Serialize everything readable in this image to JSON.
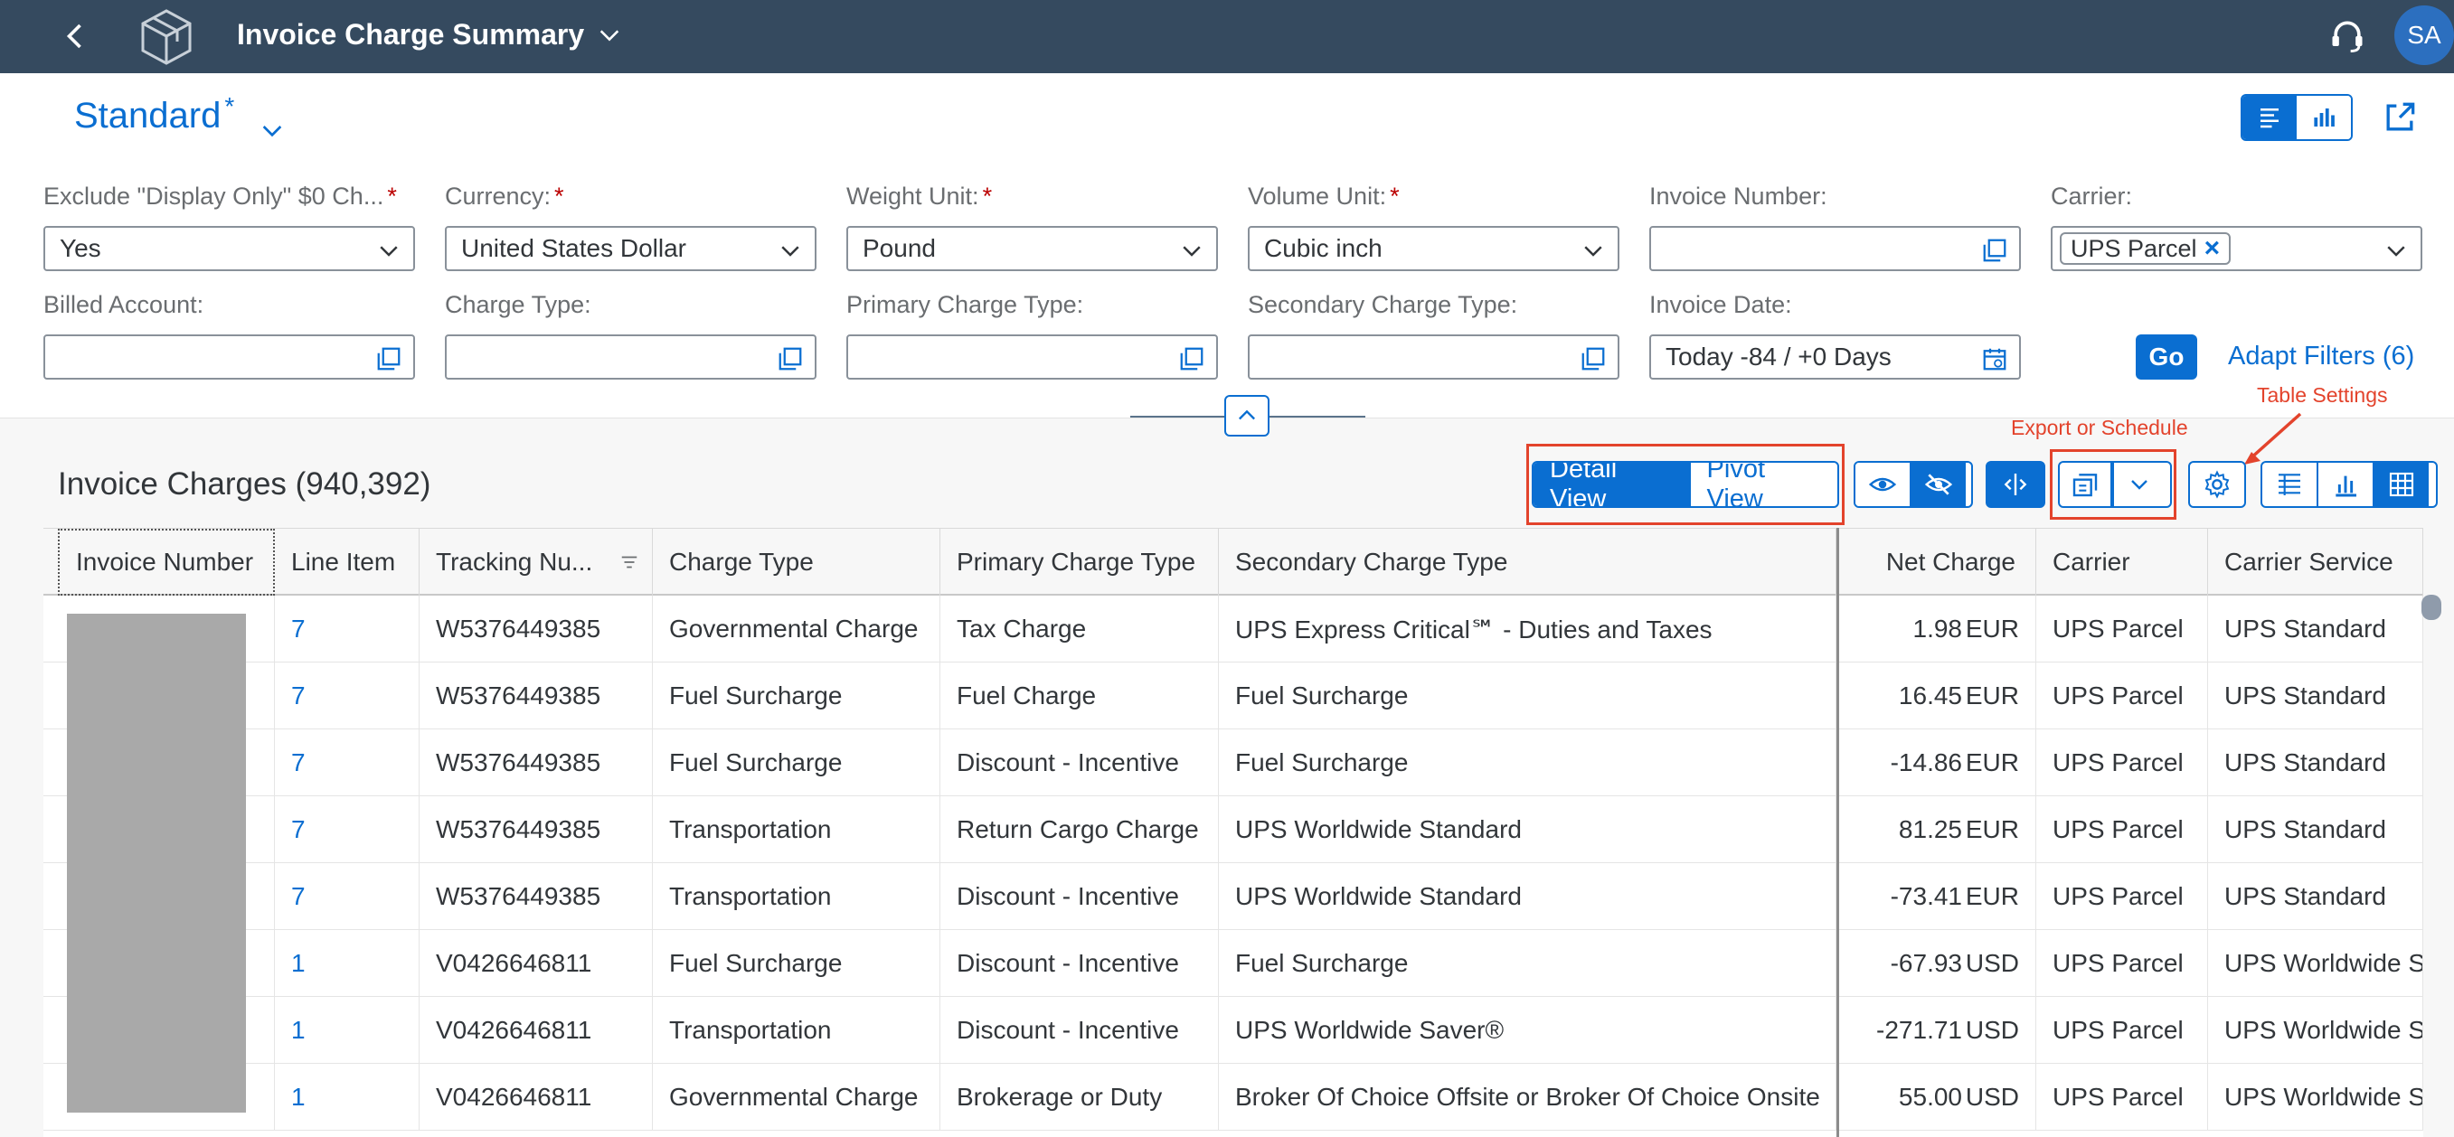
{
  "shell": {
    "title": "Invoice Charge Summary",
    "avatar": "SA"
  },
  "variant": {
    "name": "Standard",
    "modified_marker": "*"
  },
  "filters": [
    {
      "label": "Exclude \"Display Only\" $0 Ch...",
      "required": true,
      "value": "Yes",
      "icon": "chevron-down-icon"
    },
    {
      "label": "Currency:",
      "required": true,
      "value": "United States Dollar",
      "icon": "chevron-down-icon"
    },
    {
      "label": "Weight Unit:",
      "required": true,
      "value": "Pound",
      "icon": "chevron-down-icon"
    },
    {
      "label": "Volume Unit:",
      "required": true,
      "value": "Cubic inch",
      "icon": "chevron-down-icon"
    },
    {
      "label": "Invoice Number:",
      "required": false,
      "value": "",
      "icon": "value-help-icon"
    },
    {
      "label": "Carrier:",
      "required": false,
      "value": "",
      "token": "UPS Parcel",
      "icon": "chevron-down-icon"
    },
    {
      "label": "Billed Account:",
      "required": false,
      "value": "",
      "icon": "value-help-icon"
    },
    {
      "label": "Charge Type:",
      "required": false,
      "value": "",
      "icon": "value-help-icon"
    },
    {
      "label": "Primary Charge Type:",
      "required": false,
      "value": "",
      "icon": "value-help-icon"
    },
    {
      "label": "Secondary Charge Type:",
      "required": false,
      "value": "",
      "icon": "value-help-icon"
    },
    {
      "label": "Invoice Date:",
      "required": false,
      "value": "Today -84 / +0 Days",
      "icon": "calendar-icon"
    }
  ],
  "required_marker": "*",
  "go_label": "Go",
  "adapt_filters_label": "Adapt Filters (6)",
  "annotations": {
    "export": "Export or Schedule",
    "table_settings": "Table Settings"
  },
  "table": {
    "title": "Invoice Charges (940,392)",
    "views": [
      "Detail View",
      "Pivot View"
    ],
    "active_view": "Detail View",
    "columns": [
      "Invoice Number",
      "Line Item",
      "Tracking Nu...",
      "Charge Type",
      "Primary Charge Type",
      "Secondary Charge Type",
      "Net Charge",
      "Carrier",
      "Carrier Service"
    ],
    "rows": [
      {
        "line": "7",
        "tracking": "W5376449385",
        "charge_type": "Governmental Charge",
        "primary": "Tax Charge",
        "secondary": "UPS Express Critical℠ - Duties and Taxes",
        "net": "1.98",
        "currency": "EUR",
        "carrier": "UPS Parcel",
        "service": "UPS Standard"
      },
      {
        "line": "7",
        "tracking": "W5376449385",
        "charge_type": "Fuel Surcharge",
        "primary": "Fuel Charge",
        "secondary": "Fuel Surcharge",
        "net": "16.45",
        "currency": "EUR",
        "carrier": "UPS Parcel",
        "service": "UPS Standard"
      },
      {
        "line": "7",
        "tracking": "W5376449385",
        "charge_type": "Fuel Surcharge",
        "primary": "Discount - Incentive",
        "secondary": "Fuel Surcharge",
        "net": "-14.86",
        "currency": "EUR",
        "carrier": "UPS Parcel",
        "service": "UPS Standard"
      },
      {
        "line": "7",
        "tracking": "W5376449385",
        "charge_type": "Transportation",
        "primary": "Return Cargo Charge",
        "secondary": "UPS Worldwide Standard",
        "net": "81.25",
        "currency": "EUR",
        "carrier": "UPS Parcel",
        "service": "UPS Standard"
      },
      {
        "line": "7",
        "tracking": "W5376449385",
        "charge_type": "Transportation",
        "primary": "Discount - Incentive",
        "secondary": "UPS Worldwide Standard",
        "net": "-73.41",
        "currency": "EUR",
        "carrier": "UPS Parcel",
        "service": "UPS Standard"
      },
      {
        "line": "1",
        "tracking": "V0426646811",
        "charge_type": "Fuel Surcharge",
        "primary": "Discount - Incentive",
        "secondary": "Fuel Surcharge",
        "net": "-67.93",
        "currency": "USD",
        "carrier": "UPS Parcel",
        "service": "UPS Worldwide S"
      },
      {
        "line": "1",
        "tracking": "V0426646811",
        "charge_type": "Transportation",
        "primary": "Discount - Incentive",
        "secondary": "UPS  Worldwide Saver®",
        "net": "-271.71",
        "currency": "USD",
        "carrier": "UPS Parcel",
        "service": "UPS Worldwide S"
      },
      {
        "line": "1",
        "tracking": "V0426646811",
        "charge_type": "Governmental Charge",
        "primary": "Brokerage or Duty",
        "secondary": "Broker Of Choice Offsite or Broker Of Choice Onsite",
        "net": "55.00",
        "currency": "USD",
        "carrier": "UPS Parcel",
        "service": "UPS Worldwide S"
      }
    ]
  },
  "colors": {
    "shell": "#354a5f",
    "accent": "#0a6ed1",
    "annotation": "#e3432c",
    "required": "#bb0000",
    "redaction": "#a9a9a9"
  }
}
